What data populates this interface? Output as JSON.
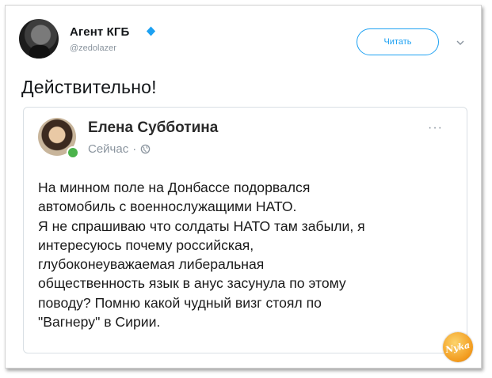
{
  "tweet": {
    "author_name": "Агент КГБ",
    "author_handle": "@zedolazer",
    "verified_icon": "verified-badge-icon",
    "follow_label": "Читать",
    "menu_icon": "chevron-down-icon",
    "text": "Действительно!"
  },
  "quoted_post": {
    "author_name": "Елена Субботина",
    "meta_time": "Сейчас",
    "meta_separator": "·",
    "privacy_icon": "globe-icon",
    "online_status": "online",
    "more_icon": "more-options-icon",
    "more_label": "···",
    "body": "На минном поле на Донбассе подорвался\nавтомобиль с военнослужащими НАТО.\nЯ не спрашиваю что солдаты НАТО там забыли, я\nинтересуюсь почему российская,\nглубоконеуважаемая либеральная\nобщественность язык в анус засунула по этому\nповоду? Помню какой чудный визг стоял по\n\"Вагнеру\" в Сирии."
  },
  "watermark": {
    "text": "Nyka"
  },
  "colors": {
    "accent": "#1da1f2",
    "online": "#4bb34b",
    "muted": "#8a949e",
    "watermark": "#f29a1d"
  }
}
